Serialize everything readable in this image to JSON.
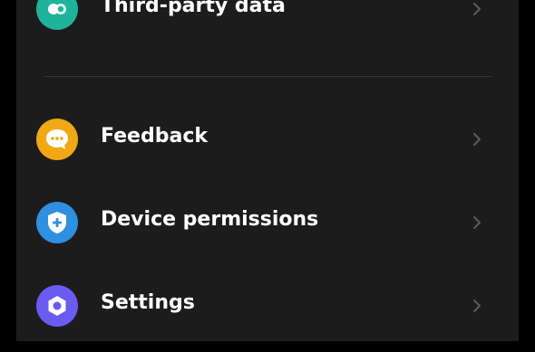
{
  "colors": {
    "background": "#000000",
    "panel": "#1c1c1c",
    "divider": "#343434",
    "text": "#ffffff",
    "chevron": "#5c5c5c"
  },
  "items": [
    {
      "label": "Third-party data",
      "icon": "toggle-circles-icon",
      "icon_color": "#1fb39c"
    },
    {
      "label": "Feedback",
      "icon": "chat-bubble-icon",
      "icon_color": "#f0a814"
    },
    {
      "label": "Device permissions",
      "icon": "shield-plus-icon",
      "icon_color": "#2f8fe0"
    },
    {
      "label": "Settings",
      "icon": "hexagon-gear-icon",
      "icon_color": "#6a5cf0"
    }
  ]
}
